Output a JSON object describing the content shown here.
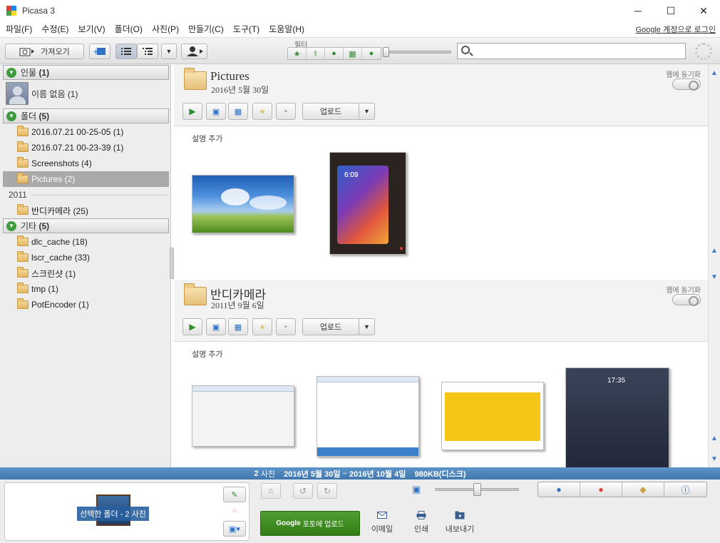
{
  "window": {
    "title": "Picasa 3",
    "controls": [
      "─",
      "☐",
      "✕"
    ]
  },
  "menu": [
    "파일(F)",
    "수정(E)",
    "보기(V)",
    "폴더(O)",
    "사진(P)",
    "만들기(C)",
    "도구(T)",
    "도움말(H)"
  ],
  "google_login": "Google 계정으로 로그인",
  "toolbar": {
    "import_label": "가져오기",
    "filter_label": "필터",
    "search_placeholder": ""
  },
  "sidebar": {
    "people_header": {
      "name": "인물",
      "count": "(1)"
    },
    "person": "이름 없음 (1)",
    "folders_header": {
      "name": "폴더",
      "count": "(5)"
    },
    "folders": [
      "2016.07.21 00-25-05 (1)",
      "2016.07.21 00-23-39 (1)",
      "Screenshots (4)",
      "Pictures (2)"
    ],
    "year": "2011",
    "year_folders": [
      "반디카메라 (25)"
    ],
    "other_header": {
      "name": "기타",
      "count": "(5)"
    },
    "other": [
      "dlc_cache (18)",
      "lscr_cache (33)",
      "스크린샷 (1)",
      "tmp (1)",
      "PotEncoder (1)"
    ]
  },
  "albums": [
    {
      "title": "Pictures",
      "date": "2016년 5월 30일",
      "web_sync": "웹에 동기화",
      "upload": "업로드",
      "desc": "설명 추가"
    },
    {
      "title": "반디카메라",
      "date": "2011년 9월 6일",
      "web_sync": "웹에 동기화",
      "upload": "업로드",
      "desc": "설명 추가"
    }
  ],
  "thumb_text": {
    "phone_time": "6:09",
    "phone2_time": "17:35"
  },
  "status": {
    "count": "2",
    "count_unit": "사진",
    "start": "2016년 5월 30일",
    "range_sep": "~",
    "end": "2016년 10월 4일",
    "size": "980KB(디스크)"
  },
  "tray": {
    "selected_label": "선택한 폴더 - 2 사진",
    "google_upload_bold": "Google",
    "google_upload_rest": "포토에 업로드",
    "email": "이메일",
    "print": "인쇄",
    "export": "내보내기"
  }
}
